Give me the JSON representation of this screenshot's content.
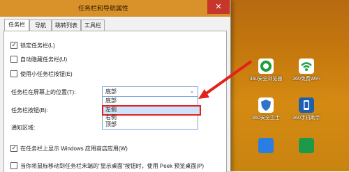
{
  "window": {
    "title": "任务栏和导航属性",
    "close_glyph": "✕"
  },
  "tabs": [
    {
      "label": "任务栏",
      "active": true
    },
    {
      "label": "导航",
      "active": false
    },
    {
      "label": "跳转列表",
      "active": false
    },
    {
      "label": "工具栏",
      "active": false
    }
  ],
  "options": {
    "lock_taskbar": {
      "label": "锁定任务栏(L)",
      "checked": true
    },
    "auto_hide": {
      "label": "自动隐藏任务栏(U)",
      "checked": false
    },
    "small_buttons": {
      "label": "使用小任务栏按钮(E)",
      "checked": false
    }
  },
  "position": {
    "label": "任务栏在屏幕上的位置(T):",
    "selected": "底部",
    "options": [
      "底部",
      "左侧",
      "右侧",
      "顶部"
    ],
    "highlighted": "左侧"
  },
  "buttons": {
    "label": "任务栏按钮(B):"
  },
  "notification": {
    "label": "通知区域:"
  },
  "store_apps": {
    "label": "在任务栏上显示 Windows 应用商店应用(W)",
    "checked": true
  },
  "peek": {
    "label": "当你将鼠标移动到任务栏末端的\"显示桌面\"按钮时，使用 Peek 预览桌面(P)",
    "checked": false
  },
  "desktop_icons": [
    {
      "label": "360安全浏览器",
      "icon": "browser-icon",
      "color": "#1f9e3a"
    },
    {
      "label": "360免费WiFi",
      "icon": "wifi-icon",
      "color": "#2aa24a"
    },
    {
      "label": "360安全卫士",
      "icon": "shield-icon",
      "color": "#2f74c9"
    },
    {
      "label": "360手机助手",
      "icon": "phone-icon",
      "color": "#1b5fae"
    },
    {
      "label": "",
      "icon": "app-icon",
      "color": "#2a7de1"
    },
    {
      "label": "",
      "icon": "app-icon",
      "color": "#1c9a4a"
    }
  ],
  "colors": {
    "accent": "#e3211a",
    "titlebar": "#d9912a"
  }
}
